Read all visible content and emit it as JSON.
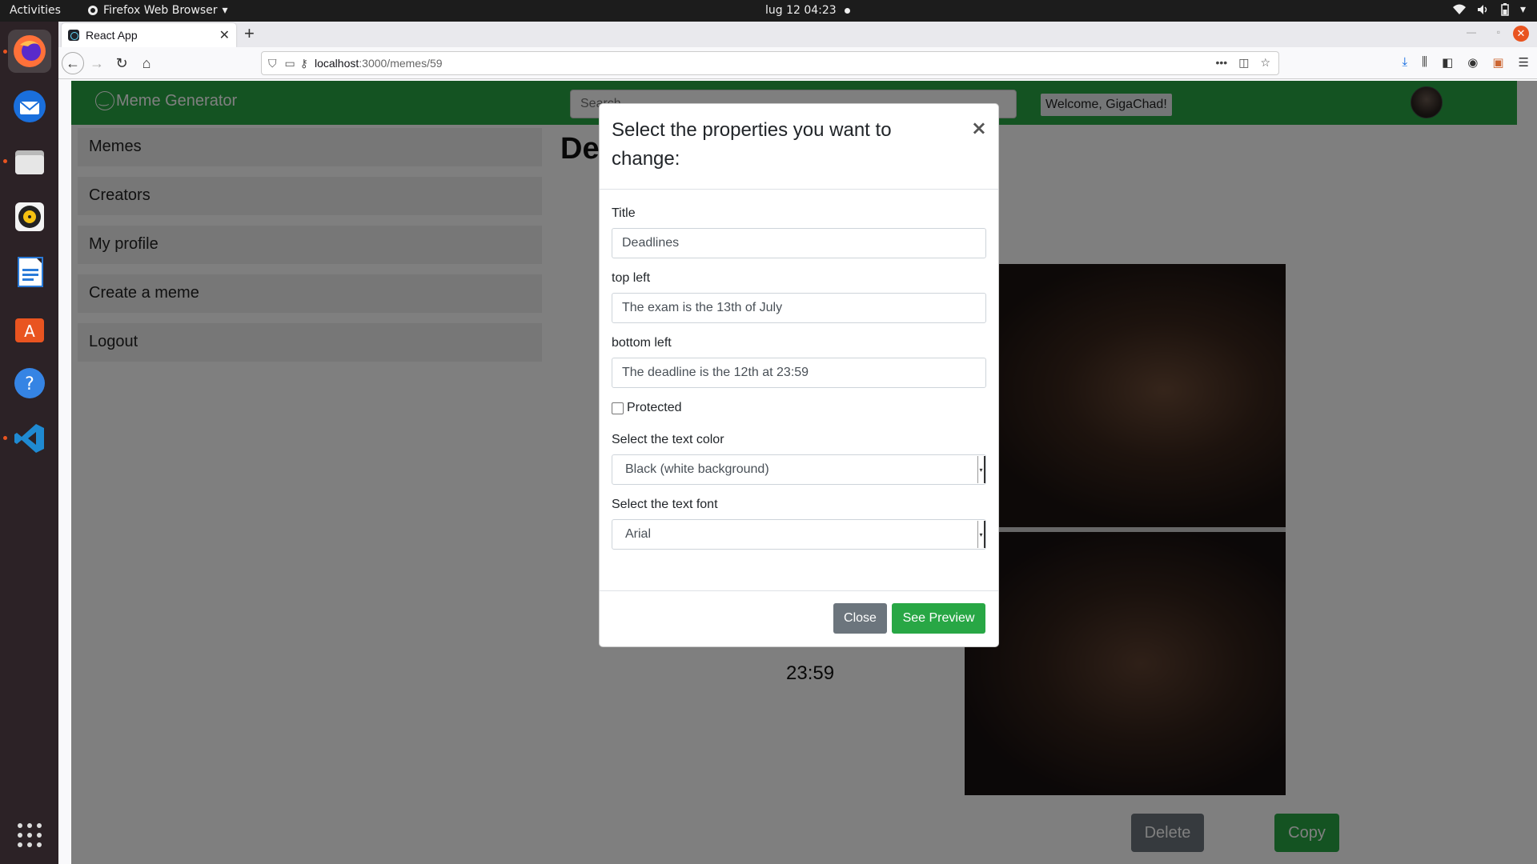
{
  "topbar": {
    "activities": "Activities",
    "app_name": "Firefox Web Browser",
    "datetime": "lug 12  04:23"
  },
  "dock": {
    "items": [
      "firefox-icon",
      "thunderbird-icon",
      "files-icon",
      "rhythmbox-icon",
      "writer-icon",
      "app-center-icon",
      "help-icon",
      "vscode-icon"
    ],
    "apps_grid": "show-apps-icon"
  },
  "browser": {
    "tab_title": "React App",
    "url_host": "localhost",
    "url_path": ":3000/memes/59"
  },
  "app": {
    "brand": "Meme Generator",
    "search_placeholder": "Search",
    "welcome": "Welcome, GigaChad!",
    "accent_color": "#28a745"
  },
  "sidebar": {
    "items": [
      "Memes",
      "Creators",
      "My profile",
      "Create a meme",
      "Logout"
    ]
  },
  "page": {
    "title_visible": "De",
    "meme_text_visible": "23:59",
    "delete_label": "Delete",
    "copy_label": "Copy"
  },
  "modal": {
    "title": "Select the properties you want to change:",
    "close_symbol": "×",
    "title_label": "Title",
    "title_value": "Deadlines",
    "top_left_label": "top left",
    "top_left_value": "The exam is the 13th of July",
    "bottom_left_label": "bottom left",
    "bottom_left_value": "The deadline is the 12th at 23:59",
    "protected_label": "Protected",
    "protected_checked": false,
    "color_label": "Select the text color",
    "color_value": "Black (white background)",
    "font_label": "Select the text font",
    "font_value": "Arial",
    "close_label": "Close",
    "preview_label": "See Preview"
  }
}
